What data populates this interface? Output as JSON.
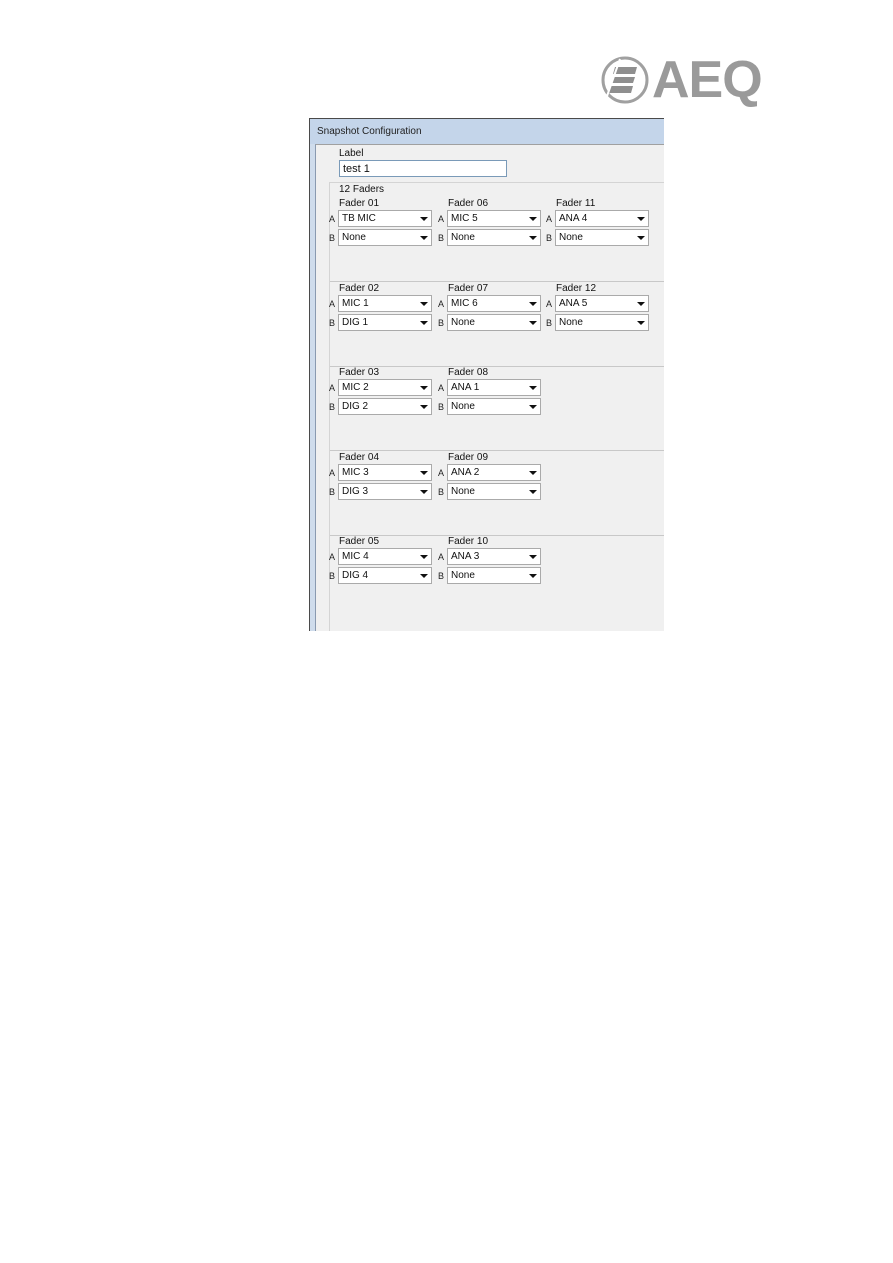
{
  "logo": {
    "text": "AEQ",
    "icon": "aeq-logo-icon"
  },
  "window": {
    "title": "Snapshot Configuration",
    "label_caption": "Label",
    "label_value": "test 1",
    "faders_title": "12 Faders",
    "channel_letters": {
      "a": "A",
      "b": "B"
    },
    "rows": [
      {
        "faders": [
          {
            "name": "Fader 01",
            "a": "TB MIC",
            "b": "None"
          },
          {
            "name": "Fader 06",
            "a": "MIC 5",
            "b": "None"
          },
          {
            "name": "Fader 11",
            "a": "ANA 4",
            "b": "None"
          }
        ]
      },
      {
        "faders": [
          {
            "name": "Fader 02",
            "a": "MIC 1",
            "b": "DIG 1"
          },
          {
            "name": "Fader 07",
            "a": "MIC 6",
            "b": "None"
          },
          {
            "name": "Fader 12",
            "a": "ANA 5",
            "b": "None"
          }
        ]
      },
      {
        "faders": [
          {
            "name": "Fader 03",
            "a": "MIC 2",
            "b": "DIG 2"
          },
          {
            "name": "Fader 08",
            "a": "ANA 1",
            "b": "None"
          }
        ]
      },
      {
        "faders": [
          {
            "name": "Fader 04",
            "a": "MIC 3",
            "b": "DIG 3"
          },
          {
            "name": "Fader 09",
            "a": "ANA 2",
            "b": "None"
          }
        ]
      },
      {
        "faders": [
          {
            "name": "Fader 05",
            "a": "MIC 4",
            "b": "DIG 4"
          },
          {
            "name": "Fader 10",
            "a": "ANA 3",
            "b": "None"
          }
        ]
      }
    ]
  }
}
